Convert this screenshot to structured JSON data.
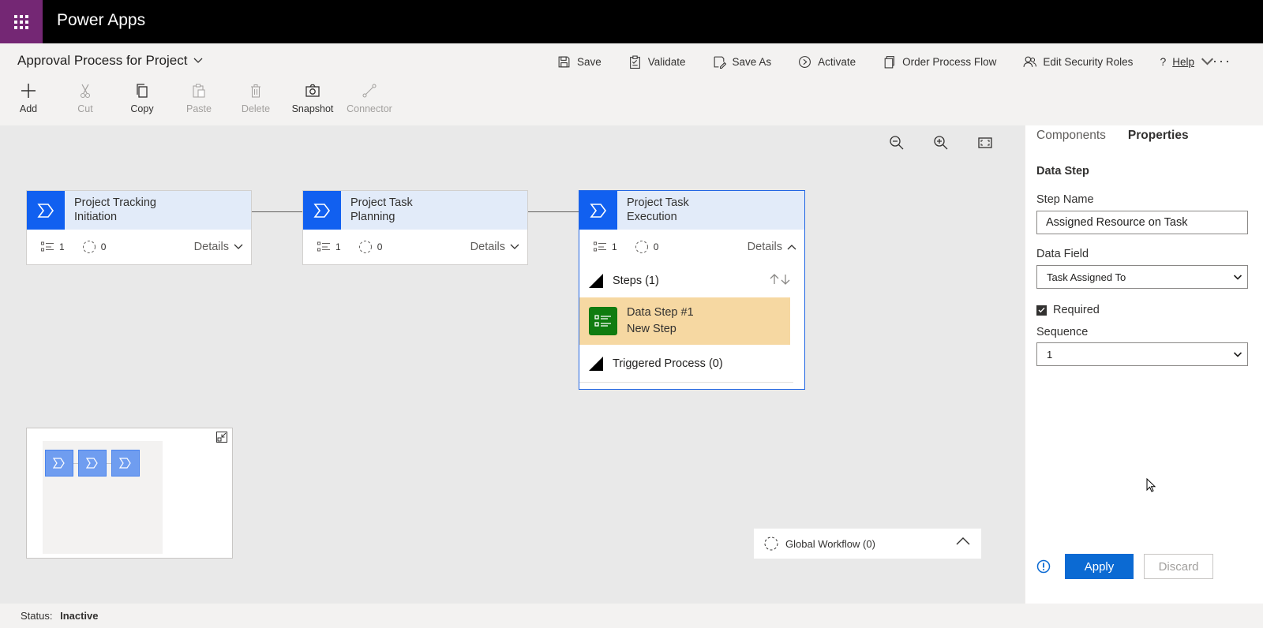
{
  "app": {
    "name": "Power Apps"
  },
  "process": {
    "title": "Approval Process for Project"
  },
  "commands": {
    "save": "Save",
    "validate": "Validate",
    "save_as": "Save As",
    "activate": "Activate",
    "order_process_flow": "Order Process Flow",
    "edit_security_roles": "Edit Security Roles",
    "help": "Help",
    "more": "···"
  },
  "tools": {
    "add": "Add",
    "cut": "Cut",
    "copy": "Copy",
    "paste": "Paste",
    "delete": "Delete",
    "snapshot": "Snapshot",
    "connector": "Connector"
  },
  "stages": [
    {
      "line1": "Project Tracking",
      "line2": "Initiation",
      "steps_count": "1",
      "workflows_count": "0",
      "details": "Details"
    },
    {
      "line1": "Project Task",
      "line2": "Planning",
      "steps_count": "1",
      "workflows_count": "0",
      "details": "Details"
    },
    {
      "line1": "Project Task",
      "line2": "Execution",
      "steps_count": "1",
      "workflows_count": "0",
      "details": "Details",
      "steps_header": "Steps (1)",
      "data_step": {
        "line1": "Data Step #1",
        "line2": "New Step"
      },
      "triggered": "Triggered Process (0)"
    }
  ],
  "global_workflow": "Global Workflow (0)",
  "status": {
    "label": "Status:",
    "value": "Inactive"
  },
  "panel": {
    "tabs": [
      "Components",
      "Properties"
    ],
    "heading": "Data Step",
    "step_name_label": "Step Name",
    "step_name_value": "Assigned Resource on Task",
    "data_field_label": "Data Field",
    "data_field_value": "Task Assigned To",
    "required_label": "Required",
    "sequence_label": "Sequence",
    "sequence_value": "1",
    "apply": "Apply",
    "discard": "Discard"
  }
}
